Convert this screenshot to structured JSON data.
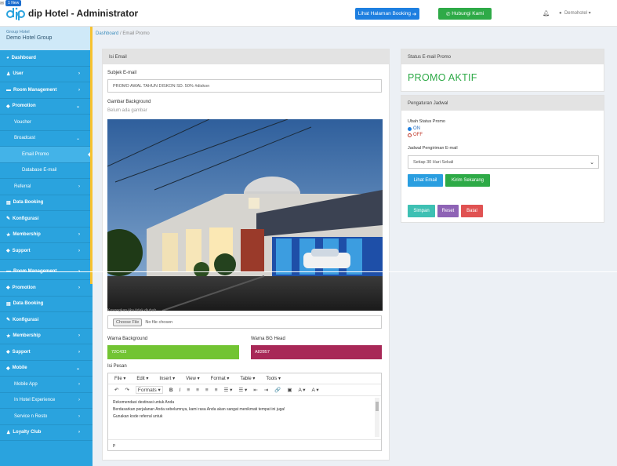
{
  "header": {
    "app_title": "dip Hotel - Administrator",
    "booking_btn": "Lihat Halaman Booking",
    "contact_btn": "Hubungi Kami",
    "mail_badge": "1 New",
    "user": "Demohotel"
  },
  "sidebar": {
    "hotel_label": "Group Hotel",
    "hotel_name": "Demo Hotel Group",
    "items": [
      "Dashboard",
      "User",
      "Room Management",
      "Promotion",
      "Voucher",
      "Broadcast",
      "Email Promo",
      "Database E-mail",
      "Referral",
      "Data Booking",
      "Konfigurasi",
      "Membership",
      "Support",
      "Room Management",
      "Promotion",
      "Data Booking",
      "Konfigurasi",
      "Membership",
      "Support",
      "Mobile",
      "Mobile App",
      "In Hotel Experience",
      "Service n Resto",
      "Loyalty Club"
    ]
  },
  "breadcrumb": {
    "home": "Dashboard",
    "current": "Email Promo"
  },
  "email_panel": {
    "title": "Isi Email",
    "subject_label": "Subjek E-mail",
    "subject_value": "PROMO AWAL TAHUN DISKON SD. 50% #diskon",
    "bg_label": "Gambar Background",
    "bg_note": "Belum ada gambar",
    "empty_note": "Kosongkan jika tidak diubah",
    "choose_file": "Choose File",
    "no_file": "No file chosen",
    "bg_color_label": "Warna Background",
    "bg_color_value": "72C433",
    "head_color_label": "Warna BG Head",
    "head_color_value": "A82857",
    "message_label": "Isi Pesan",
    "menu": [
      "File ▾",
      "Edit ▾",
      "Insert ▾",
      "View ▾",
      "Format ▾",
      "Table ▾",
      "Tools ▾"
    ],
    "toolbar": [
      "↶",
      "↷",
      "Formats ▾",
      "B",
      "I",
      "≡",
      "≡",
      "≡",
      "≡",
      "☰ ▾",
      "☰ ▾",
      "⇤",
      "⇥",
      "🔗",
      "▣",
      "A ▾",
      "A ▾"
    ],
    "body_lines": [
      "Rekomendasi destinasi untuk Anda",
      "Berdasarkan perjalanan Anda sebelumnya, kami rasa Anda akan sangat menikmati tempat ini juga!",
      "Gunakan kode referral untuk"
    ],
    "status": "p"
  },
  "status_panel": {
    "title": "Status E-mail Promo",
    "value": "PROMO AKTIF"
  },
  "schedule_panel": {
    "title": "Pengaturan Jadwal",
    "status_label": "Ubah Status Promo",
    "on": "ON",
    "off": "OFF",
    "schedule_label": "Jadwal Pengiriman E-mail",
    "schedule_value": "Setiap 30 Hari Sekali",
    "view_btn": "Lihat Email",
    "send_btn": "Kirim Sekarang",
    "save_btn": "Simpan",
    "reset_btn": "Reset",
    "cancel_btn": "Batal"
  },
  "colors": {
    "sidebar": "#2aa3de",
    "bg_color": "#72C433",
    "head_color": "#A82857",
    "green": "#2eaa47",
    "blue": "#1e7fe0"
  }
}
